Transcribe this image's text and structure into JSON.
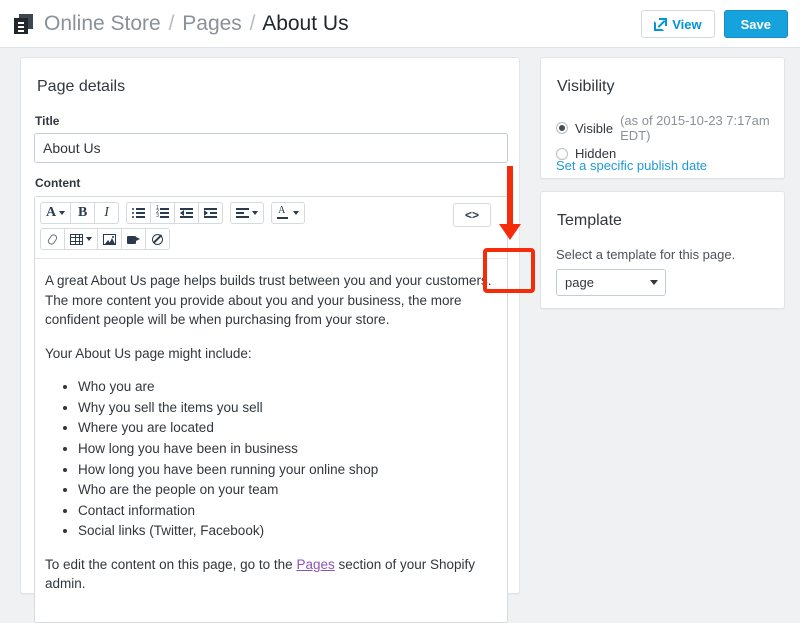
{
  "header": {
    "icon": "pages-stack-icon",
    "breadcrumb": {
      "store": "Online Store",
      "sep1": "/",
      "section": "Pages",
      "sep2": "/",
      "current": "About Us"
    },
    "view_button": "View",
    "save_button": "Save",
    "accent_blue": "#16a3dd"
  },
  "details": {
    "heading": "Page details",
    "title_label": "Title",
    "title_value": "About Us",
    "title_placeholder": "e.g. About Us",
    "content_label": "Content"
  },
  "toolbar": {
    "row1": [
      {
        "name": "font-size-button",
        "glyph": "A",
        "caret": true
      },
      {
        "name": "bold-button",
        "glyph": "B",
        "caret": false
      },
      {
        "name": "italic-button",
        "glyph": "I",
        "caret": false
      },
      {
        "name": "bulleted-list-button",
        "glyph": "ul",
        "caret": false
      },
      {
        "name": "numbered-list-button",
        "glyph": "ol",
        "caret": false
      },
      {
        "name": "outdent-button",
        "glyph": "outdent",
        "caret": false
      },
      {
        "name": "indent-button",
        "glyph": "indent",
        "caret": false
      },
      {
        "name": "align-button",
        "glyph": "align",
        "caret": true
      },
      {
        "name": "text-color-button",
        "glyph": "Acolor",
        "caret": true
      }
    ],
    "row2": [
      {
        "name": "insert-link-button",
        "glyph": "link",
        "caret": false
      },
      {
        "name": "insert-table-button",
        "glyph": "table",
        "caret": true
      },
      {
        "name": "insert-image-button",
        "glyph": "image",
        "caret": false
      },
      {
        "name": "insert-video-button",
        "glyph": "video",
        "caret": false
      },
      {
        "name": "clear-formatting-button",
        "glyph": "noformat",
        "caret": false
      }
    ],
    "code_button_label": "<>",
    "code_button_name": "edit-html-button",
    "highlight_color": "#f42c0a"
  },
  "content": {
    "paragraph1": "A great About Us page helps builds trust between you and your customers. The more content you provide about you and your business, the more confident people will be when purchasing from your store.",
    "paragraph2": "Your About Us page might include:",
    "bullets": [
      "Who you are",
      "Why you sell the items you sell",
      "Where you are located",
      "How long you have been in business",
      "How long you have been running your online shop",
      "Who are the people on your team",
      "Contact information",
      "Social links (Twitter, Facebook)"
    ],
    "closing_before": "To edit the content on this page, go to the ",
    "closing_link": "Pages",
    "closing_after": " section of your Shopify admin.",
    "link_color": "#8d53b5"
  },
  "visibility": {
    "heading": "Visibility",
    "visible_label": "Visible",
    "visible_meta": "(as of 2015-10-23 7:17am EDT)",
    "hidden_label": "Hidden",
    "selected": "Visible",
    "publish_date_link": "Set a specific publish date"
  },
  "template": {
    "heading": "Template",
    "help": "Select a template for this page.",
    "selected": "page",
    "options": [
      "page"
    ]
  }
}
